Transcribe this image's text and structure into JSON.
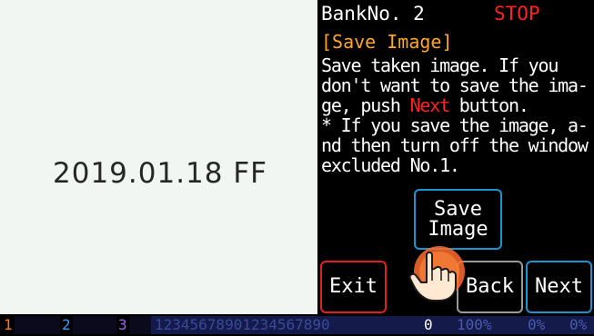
{
  "captured_image": {
    "text": "2019.01.18 FF"
  },
  "header": {
    "bank": "BankNo. 2",
    "status": "STOP",
    "status_color": "#ff2020"
  },
  "dialog": {
    "title": "[Save Image]",
    "lines": [
      {
        "before": "Save taken image.  If you",
        "highlight": "",
        "after": ""
      },
      {
        "before": "don't want to save the ima-",
        "highlight": "",
        "after": ""
      },
      {
        "before": "ge, push ",
        "highlight": "Next",
        "after": " button."
      },
      {
        "before": "* If you save the image, a-",
        "highlight": "",
        "after": ""
      },
      {
        "before": "nd then turn off the window",
        "highlight": "",
        "after": ""
      },
      {
        "before": "excluded No.1.",
        "highlight": "",
        "after": ""
      }
    ]
  },
  "buttons": {
    "save_line1": "Save",
    "save_line2": "Image",
    "exit": "Exit",
    "back": "Back",
    "next": "Next"
  },
  "status_bar": {
    "slot1": "1",
    "slot2": "2",
    "slot3": "3",
    "digits": "12345678901234567890",
    "counter": "0",
    "percent1": "100%",
    "percent2": "0%",
    "percent3": "0%"
  },
  "icons": {
    "pointer": "pointing-hand-icon"
  },
  "colors": {
    "accent_blue": "#1a95d2",
    "exit_red": "#e02020",
    "title_orange": "#ffa52a"
  }
}
